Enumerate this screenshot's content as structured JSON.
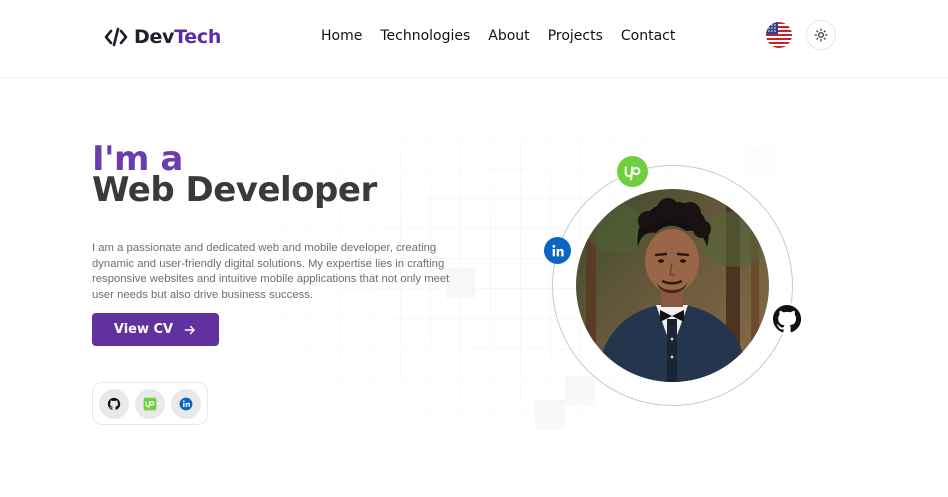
{
  "header": {
    "logo": {
      "code_symbol": "</>",
      "name_part1": "Dev",
      "name_part2": "Tech"
    },
    "nav": [
      {
        "label": "Home"
      },
      {
        "label": "Technologies"
      },
      {
        "label": "About"
      },
      {
        "label": "Projects"
      },
      {
        "label": "Contact"
      }
    ],
    "language_icon": "us-flag-icon",
    "theme_icon": "sun-icon"
  },
  "hero": {
    "prefix": "I'm a",
    "role": "Web Developer",
    "description": "I am a passionate and dedicated web and mobile developer, creating dynamic and user-friendly digital solutions. My expertise lies in crafting responsive websites and intuitive mobile applications that not only meet user needs but also drive business success.",
    "cv_button": {
      "label": "View CV",
      "icon": "arrow-right-icon"
    },
    "social_icons": [
      "github-icon",
      "upwork-icon",
      "linkedin-icon"
    ]
  },
  "profile": {
    "photo": "developer-portrait",
    "orbit_icons": [
      "upwork-icon",
      "linkedin-icon",
      "github-icon"
    ]
  },
  "colors": {
    "brand_purple": "#61329f",
    "heading_purple": "#6b3bb0",
    "heading_dark": "#3a3a3a",
    "upwork_green": "#6fcf3e",
    "linkedin_blue": "#0b66c2"
  }
}
